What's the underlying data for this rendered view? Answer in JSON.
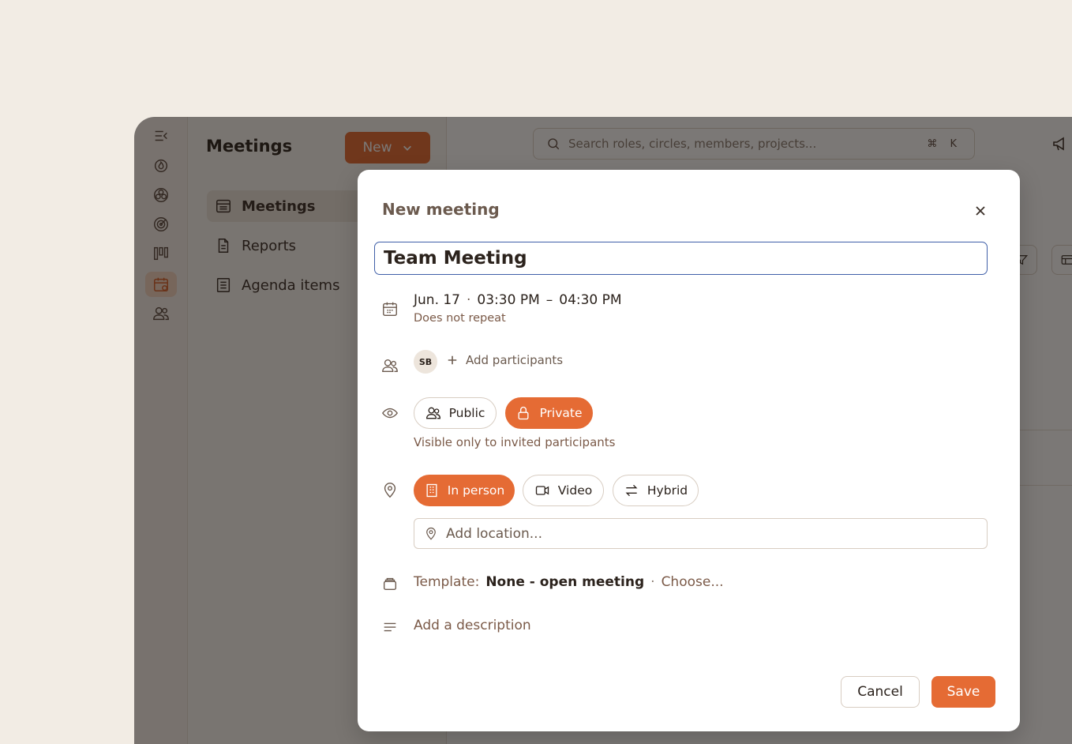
{
  "sidebar": {
    "title": "Meetings",
    "new_label": "New",
    "items": [
      {
        "label": "Meetings",
        "icon": "meetings-list-icon"
      },
      {
        "label": "Reports",
        "icon": "document-icon"
      },
      {
        "label": "Agenda items",
        "icon": "list-icon"
      }
    ]
  },
  "search": {
    "placeholder": "Search roles, circles, members, projects...",
    "shortcut": "⌘ K"
  },
  "modal": {
    "title": "New meeting",
    "meeting_title": "Team Meeting",
    "date": "Jun. 17",
    "start_time": "03:30 PM",
    "end_time": "04:30 PM",
    "date_sep": "·",
    "time_sep": "–",
    "repeat": "Does not repeat",
    "participant_initials": "SB",
    "add_participants": "Add participants",
    "visibility": {
      "public_label": "Public",
      "private_label": "Private",
      "selected": "Private",
      "hint": "Visible only to invited participants"
    },
    "location_type": {
      "in_person_label": "In person",
      "video_label": "Video",
      "hybrid_label": "Hybrid",
      "selected": "In person"
    },
    "location_placeholder": "Add location...",
    "template_label": "Template:",
    "template_value": "None - open meeting",
    "template_sep": "·",
    "template_choose": "Choose...",
    "description_placeholder": "Add a description",
    "cancel_label": "Cancel",
    "save_label": "Save"
  },
  "colors": {
    "accent": "#e56b34",
    "focus_border": "#3f5fa8",
    "background": "#f2ece4"
  }
}
